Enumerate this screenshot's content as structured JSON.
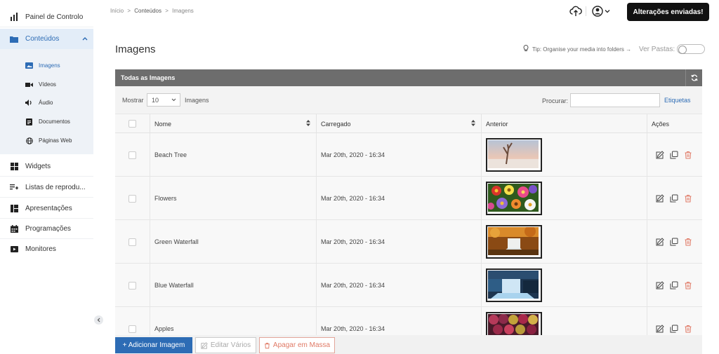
{
  "sidebar": {
    "dashboard": {
      "label": "Painel de Controlo",
      "icon": "bar-chart-icon"
    },
    "content": {
      "label": "Conteúdos",
      "icon": "folder-icon"
    },
    "sub": [
      {
        "label": "Imagens",
        "icon": "image-icon"
      },
      {
        "label": "Vídeos",
        "icon": "video-icon"
      },
      {
        "label": "Áudio",
        "icon": "audio-icon"
      },
      {
        "label": "Documentos",
        "icon": "document-icon"
      },
      {
        "label": "Páginas Web",
        "icon": "globe-icon"
      }
    ],
    "items": [
      {
        "label": "Widgets",
        "icon": "widgets-icon"
      },
      {
        "label": "Listas de reprodu...",
        "icon": "playlist-icon"
      },
      {
        "label": "Apresentações",
        "icon": "presentation-icon"
      },
      {
        "label": "Programações",
        "icon": "calendar-icon"
      },
      {
        "label": "Monitores",
        "icon": "monitor-icon"
      }
    ]
  },
  "topbar": {
    "breadcrumb": [
      "Início",
      ">",
      "Conteúdos",
      ">",
      "Imagens"
    ],
    "save_label": "Alterações enviadas!"
  },
  "page": {
    "title": "Imagens",
    "tip": "Tip: Organise your media into folders →",
    "ver_pastas": "Ver Pastas:"
  },
  "panel": {
    "title": "Todas as Imagens",
    "show_label": "Mostrar",
    "show_value": "10",
    "show_suffix": "Imagens",
    "search_label": "Procurar:",
    "search_placeholder": "",
    "tags_link": "Etiquetas"
  },
  "table": {
    "columns": [
      "Nome",
      "Carregado",
      "Anterior",
      "Ações"
    ],
    "rows": [
      {
        "name": "Beach Tree",
        "uploaded": "Mar 20th, 2020 - 16:34"
      },
      {
        "name": "Flowers",
        "uploaded": "Mar 20th, 2020 - 16:34"
      },
      {
        "name": "Green Waterfall",
        "uploaded": "Mar 20th, 2020 - 16:34"
      },
      {
        "name": "Blue Waterfall",
        "uploaded": "Mar 20th, 2020 - 16:34"
      },
      {
        "name": "Apples",
        "uploaded": "Mar 20th, 2020 - 16:34"
      }
    ]
  },
  "bottom": {
    "add_label": "+ Adicionar Imagem",
    "edit_label": "Editar Vários",
    "delete_label": "Apagar em Massa"
  },
  "colors": {
    "accent": "#2d6cb5",
    "danger": "#e07a66",
    "header": "#6d6d6d"
  }
}
